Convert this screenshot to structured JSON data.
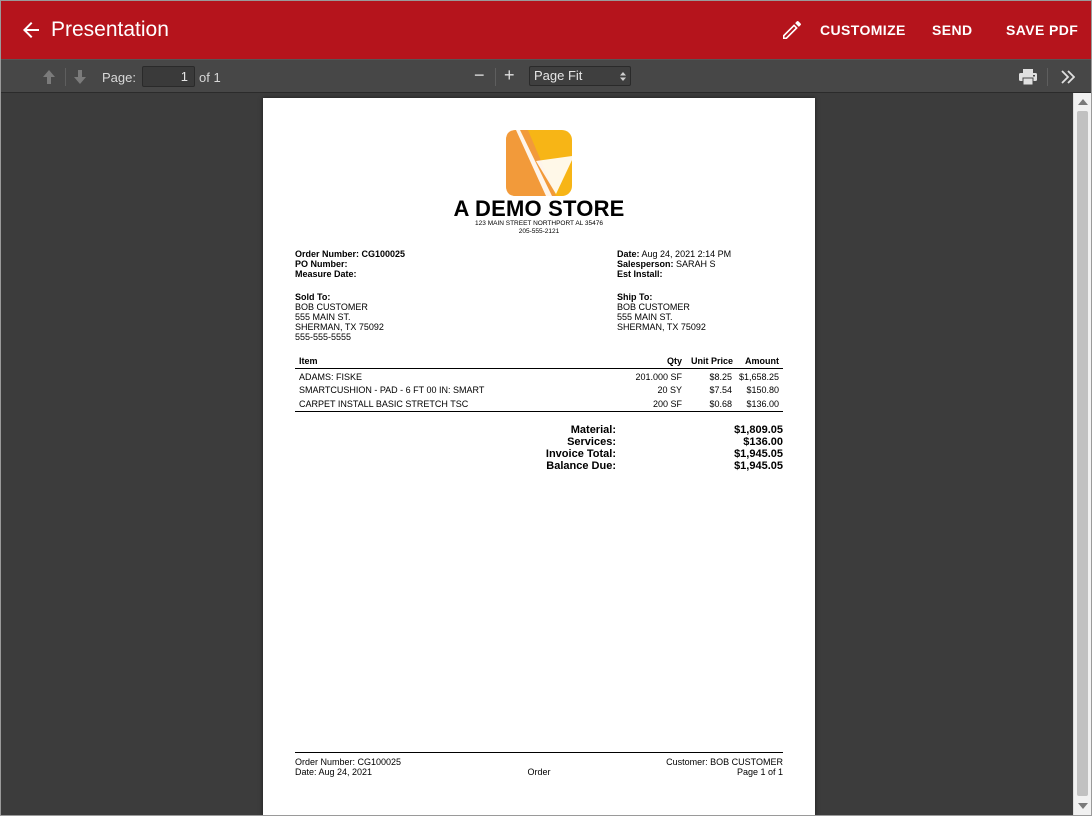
{
  "appbar": {
    "title": "Presentation",
    "customize": "CUSTOMIZE",
    "send": "SEND",
    "save_pdf": "SAVE PDF",
    "color": "#b5141c"
  },
  "pdf_toolbar": {
    "page_label": "Page:",
    "page_value": "1",
    "page_of": "of 1",
    "zoom_out": "−",
    "zoom_in": "+",
    "zoom_value": "Page Fit"
  },
  "document": {
    "store_name": "A DEMO STORE",
    "address_line": "123 MAIN STREET NORTHPORT AL 35476",
    "phone_line": "205-555-2121",
    "header_left": [
      {
        "label": "Order Number:",
        "value": "CG100025"
      },
      {
        "label": "PO Number:",
        "value": ""
      },
      {
        "label": "Measure Date:",
        "value": ""
      }
    ],
    "header_right": [
      {
        "label": "Date:",
        "value": "Aug 24, 2021 2:14 PM"
      },
      {
        "label": "Salesperson:",
        "value": "SARAH S"
      },
      {
        "label": "Est Install:",
        "value": ""
      }
    ],
    "sold_to": {
      "label": "Sold To:",
      "lines": [
        "BOB CUSTOMER",
        "555 MAIN ST.",
        "SHERMAN, TX 75092",
        "555-555-5555"
      ]
    },
    "ship_to": {
      "label": "Ship To:",
      "lines": [
        "BOB CUSTOMER",
        "555 MAIN ST.",
        "SHERMAN, TX 75092"
      ]
    },
    "table": {
      "headers": {
        "item": "Item",
        "qty": "Qty",
        "unit_price": "Unit Price",
        "amount": "Amount"
      },
      "rows": [
        {
          "item": "ADAMS: FISKE",
          "qty": "201.000 SF",
          "unit_price": "$8.25",
          "amount": "$1,658.25"
        },
        {
          "item": "SMARTCUSHION - PAD - 6 FT 00 IN: SMART",
          "qty": "20 SY",
          "unit_price": "$7.54",
          "amount": "$150.80"
        },
        {
          "item": "CARPET INSTALL BASIC STRETCH TSC",
          "qty": "200 SF",
          "unit_price": "$0.68",
          "amount": "$136.00"
        }
      ]
    },
    "totals": [
      {
        "label": "Material:",
        "value": "$1,809.05"
      },
      {
        "label": "Services:",
        "value": "$136.00"
      },
      {
        "label": "Invoice Total:",
        "value": "$1,945.05"
      },
      {
        "label": "Balance Due:",
        "value": "$1,945.05"
      }
    ],
    "footer": {
      "order_number": "Order Number: CG100025",
      "date": "Date: Aug 24, 2021",
      "center": "Order",
      "customer": "Customer: BOB CUSTOMER",
      "page": "Page 1 of 1"
    },
    "logo_colors": {
      "primary": "#f7b516",
      "secondary": "#f29a3a"
    }
  }
}
